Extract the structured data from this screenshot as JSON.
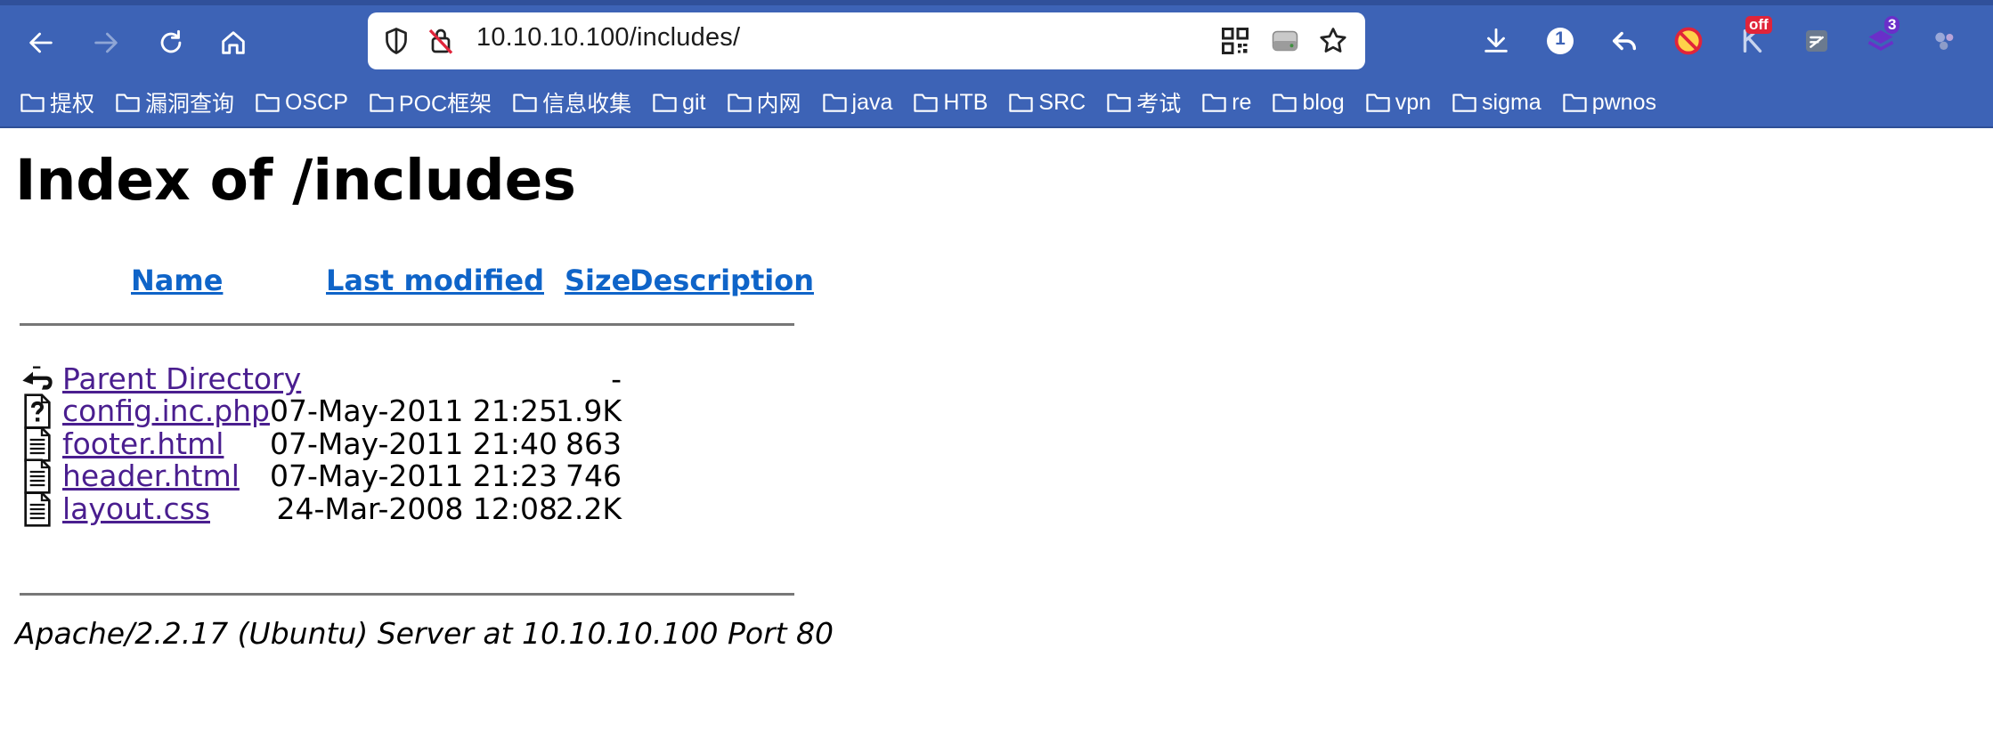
{
  "browser": {
    "url": "10.10.10.100/includes/",
    "extension_badges": {
      "counter": "1",
      "off_label": "off",
      "layers_count": "3"
    },
    "bookmarks": [
      "提权",
      "漏洞查询",
      "OSCP",
      "POC框架",
      "信息收集",
      "git",
      "内网",
      "java",
      "HTB",
      "SRC",
      "考试",
      "re",
      "blog",
      "vpn",
      "sigma",
      "pwnos"
    ],
    "colors": {
      "toolbar": "#3d63b6",
      "link": "#0f64c8",
      "visited_link": "#4a1e8f"
    }
  },
  "page": {
    "title": "Index of /includes",
    "columns": {
      "name": "Name",
      "last_modified": "Last modified",
      "size": "Size",
      "description": "Description"
    },
    "rows": [
      {
        "icon": "parent-directory-icon",
        "name": "Parent Directory",
        "modified": "",
        "size": "-"
      },
      {
        "icon": "unknown-file-icon",
        "name": "config.inc.php",
        "modified": "07-May-2011 21:25",
        "size": "1.9K"
      },
      {
        "icon": "text-file-icon",
        "name": "footer.html",
        "modified": "07-May-2011 21:40",
        "size": "863"
      },
      {
        "icon": "text-file-icon",
        "name": "header.html",
        "modified": "07-May-2011 21:23",
        "size": "746"
      },
      {
        "icon": "text-file-icon",
        "name": "layout.css",
        "modified": "24-Mar-2008 12:08",
        "size": "2.2K"
      }
    ],
    "server_signature": "Apache/2.2.17 (Ubuntu) Server at 10.10.10.100 Port 80"
  }
}
